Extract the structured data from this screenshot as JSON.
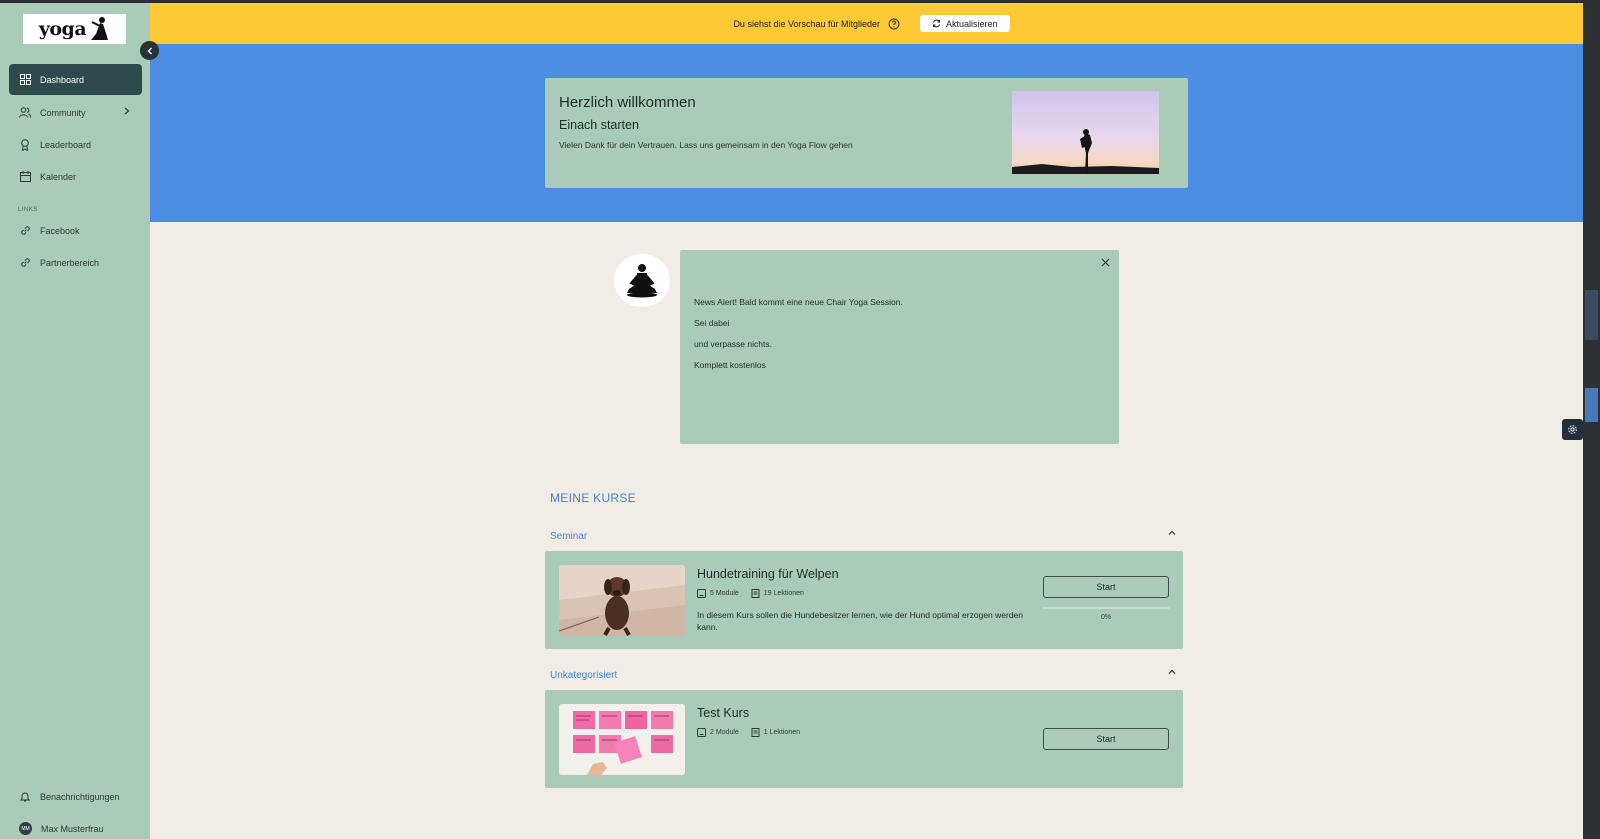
{
  "sidebar": {
    "logo_text": "yoga",
    "nav": [
      {
        "label": "Dashboard",
        "icon": "grid-icon",
        "active": true
      },
      {
        "label": "Community",
        "icon": "users-icon"
      },
      {
        "label": "Leaderboard",
        "icon": "trophy-icon"
      },
      {
        "label": "Kalender",
        "icon": "calendar-icon"
      }
    ],
    "links_label": "LINKS",
    "links": [
      {
        "label": "Facebook",
        "icon": "link-icon"
      },
      {
        "label": "Partnerbereich",
        "icon": "link-icon"
      }
    ],
    "bottom": {
      "notifications": "Benachrichtigungen",
      "user_name": "Max Musterfrau",
      "user_initials": "MM"
    }
  },
  "preview_bar": {
    "text": "Du siehst die Vorschau für Mitglieder",
    "refresh_label": "Aktualisieren",
    "color": "#fdc935"
  },
  "welcome": {
    "title": "Herzlich willkommen",
    "subtitle": "Einach starten",
    "text": "Vielen Dank für dein Vertrauen. Lass uns gemeinsam in den Yoga Flow gehen"
  },
  "news": {
    "lines": [
      "News Alert! Bald kommt eine neue Chair Yoga Session.",
      "Sei dabei",
      "und verpasse nichts.",
      "Komplett kostenlos"
    ]
  },
  "courses": {
    "section_title": "MEINE KURSE",
    "categories": [
      {
        "name": "Seminar",
        "course": {
          "title": "Hundetraining für Welpen",
          "modules": "5 Module",
          "lessons": "19 Lektionen",
          "description": "In diesem Kurs sollen die Hundebesitzer lernen, wie der Hund optimal erzogen werden kann.",
          "button": "Start",
          "progress_label": "0%",
          "progress": 0
        }
      },
      {
        "name": "Unkategorisiert",
        "course": {
          "title": "Test Kurs",
          "modules": "2 Module",
          "lessons": "1 Lektionen",
          "button": "Start"
        }
      }
    ]
  },
  "colors": {
    "sidebar": "#a9cbb7",
    "header_blue": "#4b8ee4",
    "accent_blue": "#3f86dc",
    "active_nav": "#2f4a4c",
    "background": "#f1ece6"
  }
}
